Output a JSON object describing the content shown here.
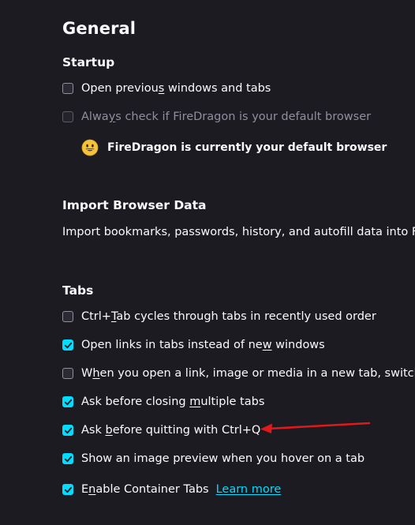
{
  "page": {
    "title": "General"
  },
  "startup": {
    "heading": "Startup",
    "open_previous": {
      "pre": "Open previou",
      "accel": "s",
      "post": " windows and tabs",
      "checked": false
    },
    "always_check": {
      "pre": "Alwa",
      "accel": "y",
      "post": "s check if FireDragon is your default browser",
      "checked": false,
      "disabled": true
    },
    "default_status": "FireDragon is currently your default browser",
    "default_status_icon": "smile-emoji-icon"
  },
  "import": {
    "heading": "Import Browser Data",
    "description": "Import bookmarks, passwords, history, and autofill data into FireDragon."
  },
  "tabs": {
    "heading": "Tabs",
    "items": [
      {
        "pre": "Ctrl+",
        "accel": "T",
        "post": "ab cycles through tabs in recently used order",
        "checked": false
      },
      {
        "pre": "Open links in tabs instead of ne",
        "accel": "w",
        "post": " windows",
        "checked": true
      },
      {
        "pre": "W",
        "accel": "h",
        "post": "en you open a link, image or media in a new tab, switch to it immediately",
        "checked": false
      },
      {
        "pre": "Ask before closing ",
        "accel": "m",
        "post": "ultiple tabs",
        "checked": true
      },
      {
        "pre": "Ask ",
        "accel": "b",
        "post": "efore quitting with Ctrl+Q",
        "checked": true
      },
      {
        "pre": "Show an image preview when you hover on a tab",
        "accel": "",
        "post": "",
        "checked": true
      },
      {
        "pre": "E",
        "accel": "n",
        "post": "able Container Tabs",
        "checked": true
      }
    ],
    "learn_more": "Learn more"
  },
  "colors": {
    "background": "#1c1b22",
    "accent": "#00ddff",
    "annotation_arrow": "#e0191b"
  }
}
